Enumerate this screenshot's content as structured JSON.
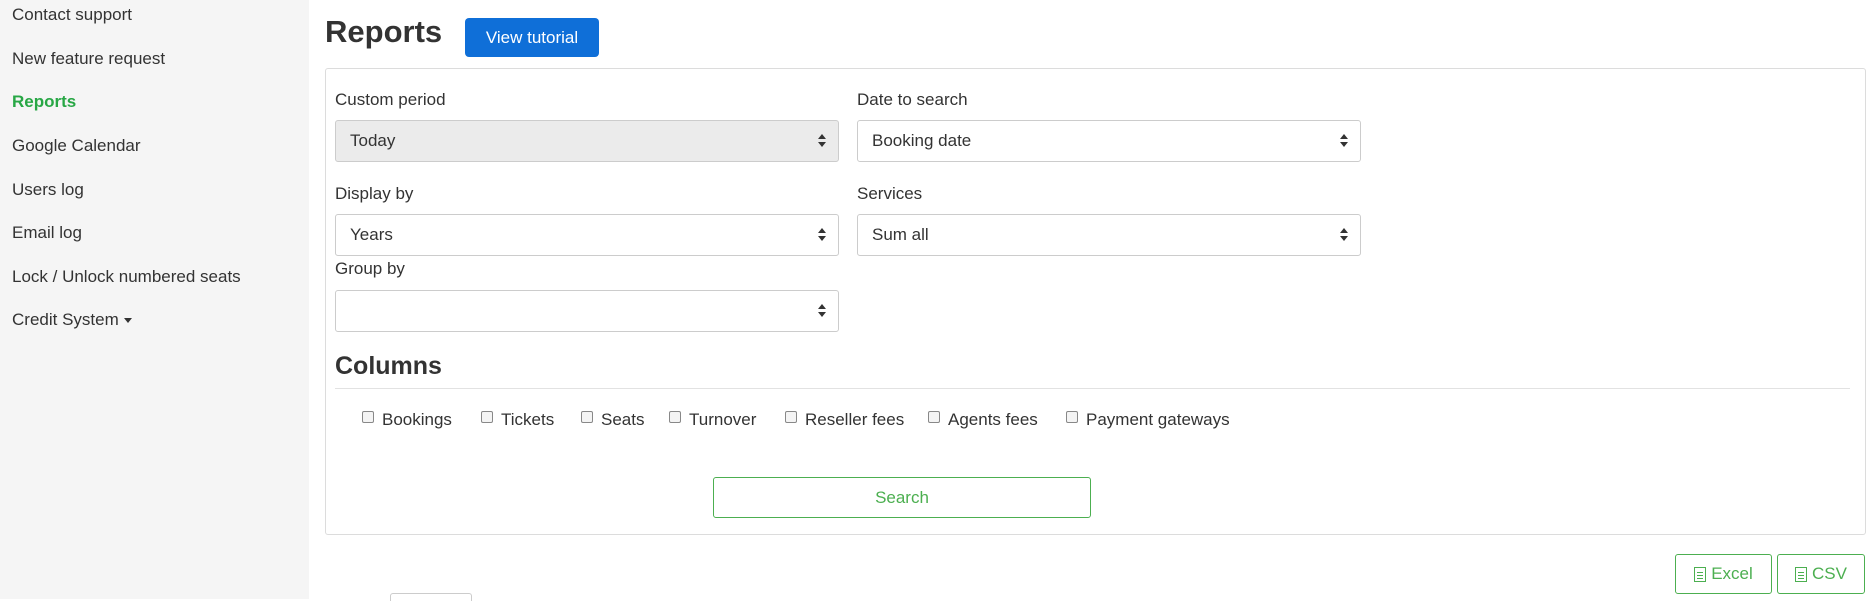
{
  "sidebar": {
    "items": [
      {
        "label": "Contact support"
      },
      {
        "label": "New feature request"
      },
      {
        "label": "Reports"
      },
      {
        "label": "Google Calendar"
      },
      {
        "label": "Users log"
      },
      {
        "label": "Email log"
      },
      {
        "label": "Lock / Unlock numbered seats"
      },
      {
        "label": "Credit System"
      }
    ]
  },
  "header": {
    "title": "Reports",
    "tutorial_button": "View tutorial"
  },
  "form": {
    "custom_period": {
      "label": "Custom period",
      "value": "Today"
    },
    "date_to_search": {
      "label": "Date to search",
      "value": "Booking date"
    },
    "display_by": {
      "label": "Display by",
      "value": "Years"
    },
    "services": {
      "label": "Services",
      "value": "Sum all"
    },
    "group_by": {
      "label": "Group by",
      "value": ""
    }
  },
  "columns": {
    "heading": "Columns",
    "options": [
      {
        "label": "Bookings",
        "checked": false
      },
      {
        "label": "Tickets",
        "checked": false
      },
      {
        "label": "Seats",
        "checked": false
      },
      {
        "label": "Turnover",
        "checked": false
      },
      {
        "label": "Reseller fees",
        "checked": false
      },
      {
        "label": "Agents fees",
        "checked": false
      },
      {
        "label": "Payment gateways",
        "checked": false
      }
    ]
  },
  "actions": {
    "search": "Search",
    "excel": "Excel",
    "csv": "CSV"
  },
  "colors": {
    "accent_green": "#4caf50",
    "active_green": "#28a745",
    "primary_blue": "#0f6fd8"
  },
  "icons": {
    "excel": "file-excel-icon",
    "csv": "file-text-icon",
    "dropdown": "caret-down-icon",
    "select": "select-arrows-icon"
  }
}
